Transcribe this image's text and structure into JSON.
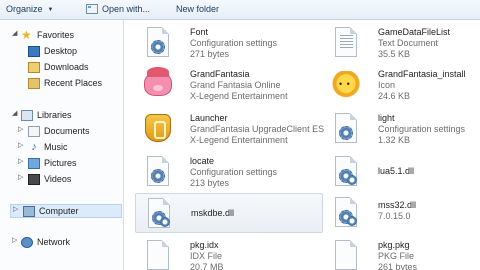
{
  "toolbar": {
    "organize": "Organize",
    "open_with": "Open with...",
    "new_folder": "New folder"
  },
  "nav": {
    "favorites": "Favorites",
    "desktop": "Desktop",
    "downloads": "Downloads",
    "recent_places": "Recent Places",
    "libraries": "Libraries",
    "documents": "Documents",
    "music": "Music",
    "pictures": "Pictures",
    "videos": "Videos",
    "computer": "Computer",
    "network": "Network"
  },
  "files": [
    {
      "name": "Font",
      "line2": "Configuration settings",
      "line3": "271 bytes",
      "icon": "settings-file-icon"
    },
    {
      "name": "GameDataFileList",
      "line2": "Text Document",
      "line3": "35.5 KB",
      "icon": "text-file-icon"
    },
    {
      "name": "GrandFantasia",
      "line2": "Grand Fantasia Online",
      "line3": "X-Legend Entertainment",
      "icon": "grandfantasia-app-icon"
    },
    {
      "name": "GrandFantasia_install",
      "line2": "Icon",
      "line3": "24.6 KB",
      "icon": "sun-icon"
    },
    {
      "name": "Launcher",
      "line2": "GrandFantasia UpgradeClient ES",
      "line3": "X-Legend Entertainment",
      "icon": "launcher-app-icon"
    },
    {
      "name": "light",
      "line2": "Configuration settings",
      "line3": "1.32 KB",
      "icon": "settings-file-icon"
    },
    {
      "name": "locate",
      "line2": "Configuration settings",
      "line3": "213 bytes",
      "icon": "settings-file-icon"
    },
    {
      "name": "lua5.1.dll",
      "line2": "",
      "line3": "",
      "icon": "dll-file-icon"
    },
    {
      "name": "mskdbe.dll",
      "line2": "",
      "line3": "",
      "icon": "dll-file-icon"
    },
    {
      "name": "mss32.dll",
      "line2": "7.0.15.0",
      "line3": "",
      "icon": "dll-file-icon"
    },
    {
      "name": "pkg.idx",
      "line2": "IDX File",
      "line3": "20.7 MB",
      "icon": "blank-file-icon"
    },
    {
      "name": "pkg.pkg",
      "line2": "PKG File",
      "line3": "261 bytes",
      "icon": "blank-file-icon"
    }
  ]
}
